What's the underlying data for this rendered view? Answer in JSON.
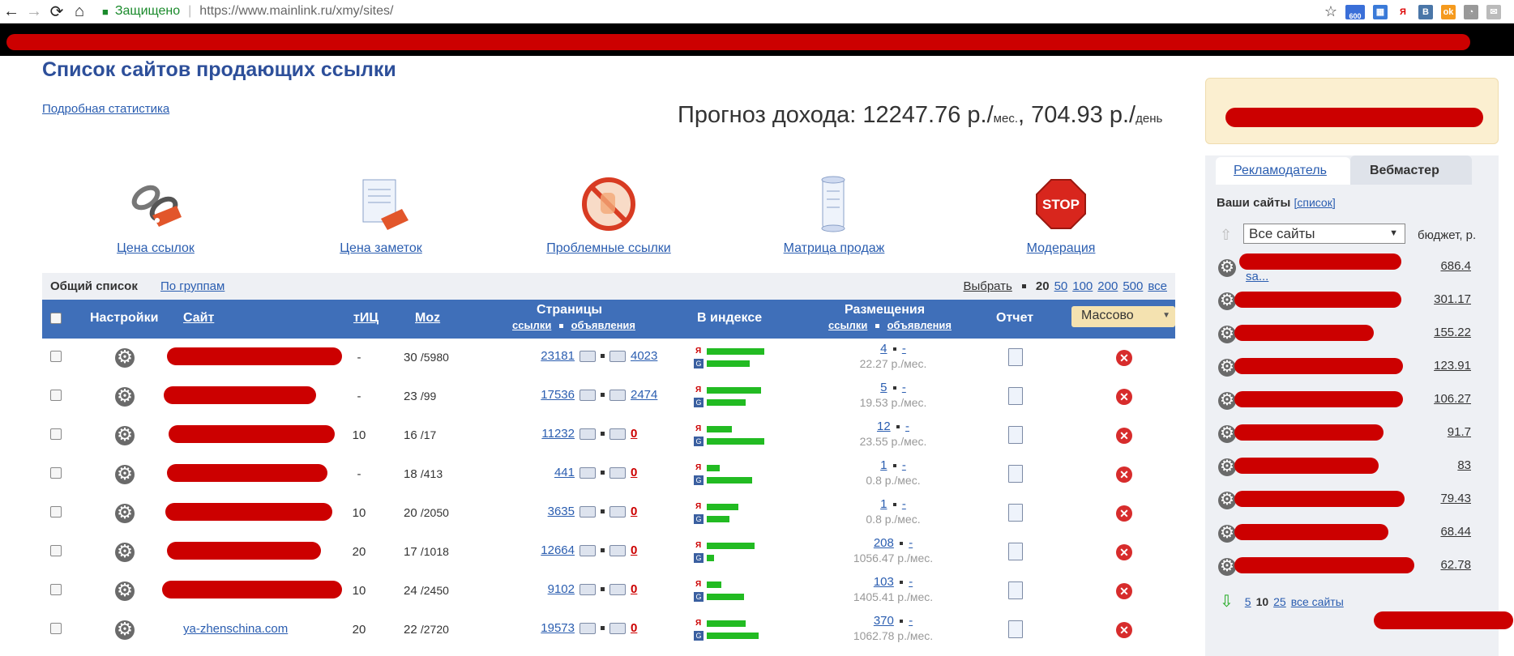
{
  "browser": {
    "secure_label": "Защищено",
    "url": "https://www.mainlink.ru/xmy/sites/",
    "badge_count": "600"
  },
  "page": {
    "title": "Список сайтов продающих ссылки",
    "stats_link": "Подробная статистика",
    "forecast_prefix": "Прогноз дохода: 12247.76 р./",
    "forecast_mes": "мес.",
    "forecast_mid": ", 704.93 р./",
    "forecast_day": "день"
  },
  "tools": [
    {
      "label": "Цена ссылок",
      "icon": "chain-link-icon"
    },
    {
      "label": "Цена заметок",
      "icon": "notes-price-icon"
    },
    {
      "label": "Проблемные ссылки",
      "icon": "forbidden-hand-icon"
    },
    {
      "label": "Матрица продаж",
      "icon": "scroll-icon"
    },
    {
      "label": "Модерация",
      "icon": "stop-sign-icon"
    }
  ],
  "list_tabs": {
    "general": "Общий список",
    "by_groups": "По группам",
    "pick": "Выбрать",
    "page_sizes": [
      "20",
      "50",
      "100",
      "200",
      "500",
      "все"
    ]
  },
  "table": {
    "headers": {
      "settings": "Настройки",
      "site": "Сайт",
      "tic": "тИЦ",
      "moz": "Moz",
      "pages": "Страницы",
      "pages_links": "ссылки",
      "pages_ads": "объявления",
      "index": "В индексе",
      "placements": "Размещения",
      "placements_links": "ссылки",
      "placements_ads": "объявления",
      "report": "Отчет",
      "mass": "Массово"
    },
    "rows": [
      {
        "site": "",
        "tic": "-",
        "moz": "30",
        "moz2": "/5980",
        "links": "23181",
        "ads": "4023",
        "ads_zero": false,
        "ya": 0.62,
        "g": 0.46,
        "place": "4",
        "place2": "-",
        "income": "22.27 р./мес."
      },
      {
        "site": "",
        "tic": "-",
        "moz": "23",
        "moz2": "/99",
        "links": "17536",
        "ads": "2474",
        "ads_zero": false,
        "ya": 0.58,
        "g": 0.42,
        "place": "5",
        "place2": "-",
        "income": "19.53 р./мес."
      },
      {
        "site": "",
        "tic": "10",
        "moz": "16",
        "moz2": "/17",
        "links": "11232",
        "ads": "0",
        "ads_zero": true,
        "ya": 0.27,
        "g": 0.62,
        "place": "12",
        "place2": "-",
        "income": "23.55 р./мес."
      },
      {
        "site": "",
        "tic": "-",
        "moz": "18",
        "moz2": "/413",
        "links": "441",
        "ads": "0",
        "ads_zero": true,
        "ya": 0.14,
        "g": 0.49,
        "place": "1",
        "place2": "-",
        "income": "0.8 р./мес."
      },
      {
        "site": "",
        "tic": "10",
        "moz": "20",
        "moz2": "/2050",
        "links": "3635",
        "ads": "0",
        "ads_zero": true,
        "ya": 0.34,
        "g": 0.24,
        "place": "1",
        "place2": "-",
        "income": "0.8 р./мес."
      },
      {
        "site": "",
        "tic": "20",
        "moz": "17",
        "moz2": "/1018",
        "links": "12664",
        "ads": "0",
        "ads_zero": true,
        "ya": 0.51,
        "g": 0.08,
        "place": "208",
        "place2": "-",
        "income": "1056.47 р./мес."
      },
      {
        "site": "",
        "tic": "10",
        "moz": "24",
        "moz2": "/2450",
        "links": "9102",
        "ads": "0",
        "ads_zero": true,
        "ya": 0.16,
        "g": 0.4,
        "place": "103",
        "place2": "-",
        "income": "1405.41 р./мес."
      },
      {
        "site": "ya-zhenschina.com",
        "tic": "20",
        "moz": "22",
        "moz2": "/2720",
        "links": "19573",
        "ads": "0",
        "ads_zero": true,
        "ya": 0.42,
        "g": 0.56,
        "place": "370",
        "place2": "-",
        "income": "1062.78 р./мес."
      }
    ]
  },
  "sidebar": {
    "tab_advertiser": "Рекламодатель",
    "tab_webmaster": "Вебмастер",
    "your_sites": "Ваши сайты",
    "list_link": "[список]",
    "select_value": "Все сайты",
    "budget_label": "бюджет, р.",
    "first_site": "sa...",
    "values": [
      "686.4",
      "301.17",
      "155.22",
      "123.91",
      "106.27",
      "91.7",
      "83",
      "79.43",
      "68.44",
      "62.78"
    ],
    "pager": [
      "5",
      "10",
      "25",
      "все сайты"
    ]
  },
  "colors": {
    "header_blue": "#3f6fb9",
    "title_blue": "#2d4f9a",
    "index_green": "#22bb22",
    "redaction_red": "#cc0000"
  }
}
